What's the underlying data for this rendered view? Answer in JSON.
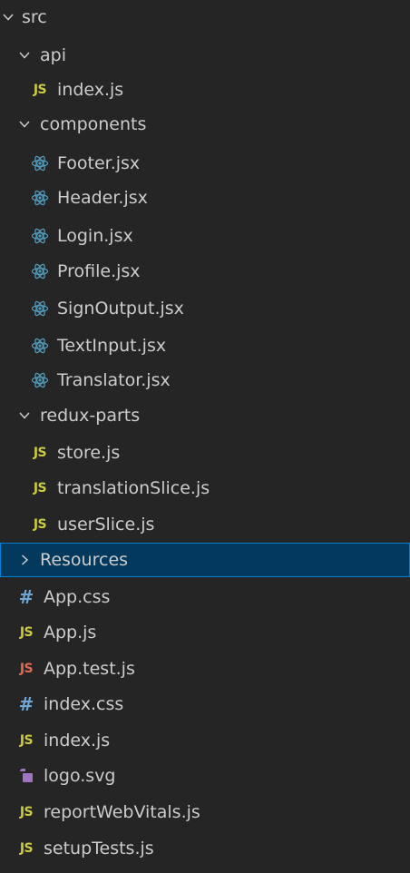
{
  "explorer": {
    "root": {
      "label": "src",
      "expanded": true
    },
    "folders": {
      "api": {
        "label": "api",
        "expanded": true,
        "files": [
          {
            "label": "index.js",
            "icon": "js-icon"
          }
        ]
      },
      "components": {
        "label": "components",
        "expanded": true,
        "files": [
          {
            "label": "Footer.jsx",
            "icon": "react-icon"
          },
          {
            "label": "Header.jsx",
            "icon": "react-icon"
          },
          {
            "label": "Login.jsx",
            "icon": "react-icon"
          },
          {
            "label": "Profile.jsx",
            "icon": "react-icon"
          },
          {
            "label": "SignOutput.jsx",
            "icon": "react-icon"
          },
          {
            "label": "TextInput.jsx",
            "icon": "react-icon"
          },
          {
            "label": "Translator.jsx",
            "icon": "react-icon"
          }
        ]
      },
      "redux_parts": {
        "label": "redux-parts",
        "expanded": true,
        "files": [
          {
            "label": "store.js",
            "icon": "js-icon"
          },
          {
            "label": "translationSlice.js",
            "icon": "js-icon"
          },
          {
            "label": "userSlice.js",
            "icon": "js-icon"
          }
        ]
      },
      "resources": {
        "label": "Resources",
        "expanded": false,
        "selected": true
      }
    },
    "files": [
      {
        "label": "App.css",
        "icon": "css-icon"
      },
      {
        "label": "App.js",
        "icon": "js-icon"
      },
      {
        "label": "App.test.js",
        "icon": "js-test-icon"
      },
      {
        "label": "index.css",
        "icon": "css-icon"
      },
      {
        "label": "index.js",
        "icon": "js-icon"
      },
      {
        "label": "logo.svg",
        "icon": "svg-icon"
      },
      {
        "label": "reportWebVitals.js",
        "icon": "js-icon"
      },
      {
        "label": "setupTests.js",
        "icon": "js-icon"
      }
    ],
    "icon_glyphs": {
      "js": "JS",
      "css": "#"
    }
  },
  "colors": {
    "background": "#252526",
    "text": "#cccccc",
    "selected_background": "#04395e",
    "selected_border": "#007fd4",
    "js_icon": "#cbcb41",
    "js_test_icon": "#e06c4f",
    "css_icon": "#6ea7d6",
    "react_icon": "#519aba",
    "svg_icon": "#a074c4"
  }
}
